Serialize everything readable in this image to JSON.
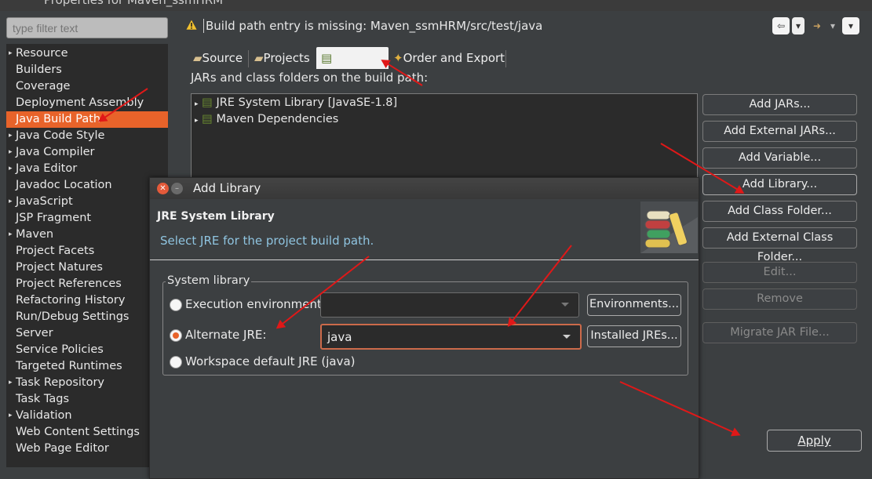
{
  "window": {
    "title": "Properties for Maven_ssmHRM"
  },
  "filter": {
    "placeholder": "type filter text"
  },
  "tree": {
    "items": [
      {
        "label": "Resource",
        "expandable": true
      },
      {
        "label": "Builders",
        "expandable": false
      },
      {
        "label": "Coverage",
        "expandable": false
      },
      {
        "label": "Deployment Assembly",
        "expandable": false
      },
      {
        "label": "Java Build Path",
        "expandable": false,
        "selected": true
      },
      {
        "label": "Java Code Style",
        "expandable": true
      },
      {
        "label": "Java Compiler",
        "expandable": true
      },
      {
        "label": "Java Editor",
        "expandable": true
      },
      {
        "label": "Javadoc Location",
        "expandable": false
      },
      {
        "label": "JavaScript",
        "expandable": true
      },
      {
        "label": "JSP Fragment",
        "expandable": false
      },
      {
        "label": "Maven",
        "expandable": true
      },
      {
        "label": "Project Facets",
        "expandable": false
      },
      {
        "label": "Project Natures",
        "expandable": false
      },
      {
        "label": "Project References",
        "expandable": false
      },
      {
        "label": "Refactoring History",
        "expandable": false
      },
      {
        "label": "Run/Debug Settings",
        "expandable": false
      },
      {
        "label": "Server",
        "expandable": false
      },
      {
        "label": "Service Policies",
        "expandable": false
      },
      {
        "label": "Targeted Runtimes",
        "expandable": false
      },
      {
        "label": "Task Repository",
        "expandable": true
      },
      {
        "label": "Task Tags",
        "expandable": false
      },
      {
        "label": "Validation",
        "expandable": true
      },
      {
        "label": "Web Content Settings",
        "expandable": false
      },
      {
        "label": "Web Page Editor",
        "expandable": false
      }
    ]
  },
  "header": {
    "warning": "Build path entry is missing: Maven_ssmHRM/src/test/java"
  },
  "tabs": [
    {
      "label": "Source",
      "icon": "folder-source-icon"
    },
    {
      "label": "Projects",
      "icon": "projects-icon"
    },
    {
      "label": "",
      "icon": "libraries-icon",
      "active": true
    },
    {
      "label": "Order and Export",
      "icon": "order-export-icon"
    }
  ],
  "buildpath": {
    "description": "JARs and class folders on the build path:",
    "entries": [
      {
        "label": "JRE System Library [JavaSE-1.8]"
      },
      {
        "label": "Maven Dependencies"
      }
    ]
  },
  "right_buttons": [
    {
      "label": "Add JARs...",
      "enabled": true
    },
    {
      "label": "Add External JARs...",
      "enabled": true
    },
    {
      "label": "Add Variable...",
      "enabled": true
    },
    {
      "label": "Add Library...",
      "enabled": true
    },
    {
      "label": "Add Class Folder...",
      "enabled": true
    },
    {
      "label": "Add External Class Folder...",
      "enabled": true
    },
    {
      "label": "Edit...",
      "enabled": false
    },
    {
      "label": "Remove",
      "enabled": false
    },
    {
      "label": "Migrate JAR File...",
      "enabled": false
    }
  ],
  "dialog": {
    "title": "Add Library",
    "heading": "JRE System Library",
    "message": "Select JRE for the project build path.",
    "group_label": "System library",
    "options": {
      "exec_env": {
        "label": "Execution environment:",
        "selected": false,
        "value": ""
      },
      "alternate": {
        "label": "Alternate JRE:",
        "selected": true,
        "value": "java"
      },
      "workspace": {
        "label": "Workspace default JRE (java)",
        "selected": false
      }
    },
    "environments_button": "Environments...",
    "installed_button": "Installed JREs..."
  },
  "apply_button": "Apply",
  "colors": {
    "accent": "#e8632a",
    "annotation": "#e01818",
    "info_text": "#8fc4e0"
  }
}
